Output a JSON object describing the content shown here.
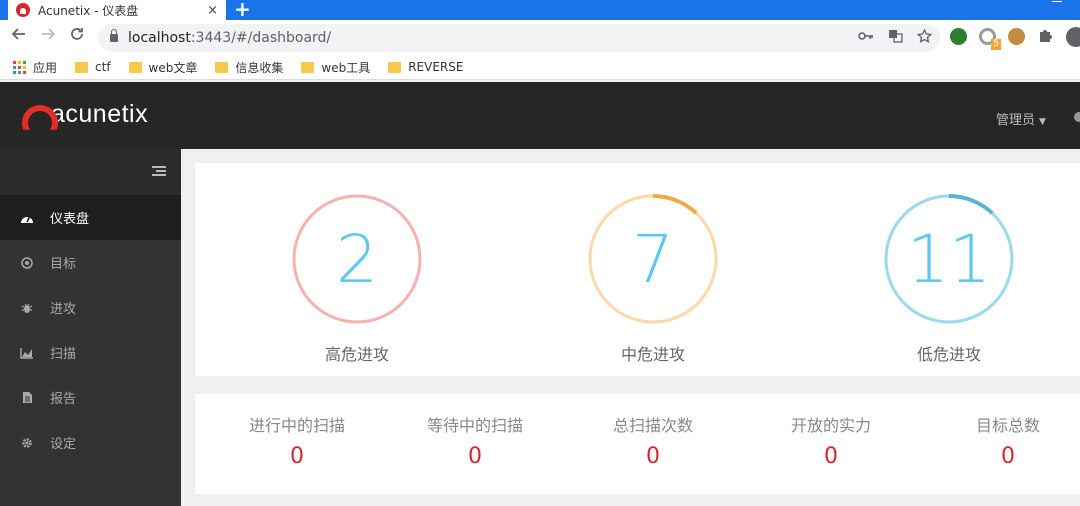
{
  "browser": {
    "tab_title": "Acunetix - 仪表盘",
    "tab_close": "×",
    "new_tab": "+",
    "url_host": "localhost",
    "url_path": ":3443/#/dashboard/",
    "ext_badge": "5",
    "icons": {
      "back": "arrow-left-icon",
      "forward": "arrow-right-icon",
      "reload": "reload-icon",
      "lock": "lock-icon",
      "key": "key-icon",
      "translate": "translate-icon",
      "star": "star-icon",
      "puzzle": "extensions-icon"
    }
  },
  "bookmarks": [
    {
      "label": "应用",
      "type": "apps"
    },
    {
      "label": "ctf",
      "type": "folder"
    },
    {
      "label": "web文章",
      "type": "folder"
    },
    {
      "label": "信息收集",
      "type": "folder"
    },
    {
      "label": "web工具",
      "type": "folder"
    },
    {
      "label": "REVERSE",
      "type": "folder"
    }
  ],
  "header": {
    "logo_text": "acunetix",
    "admin_label": "管理员"
  },
  "sidebar": {
    "items": [
      {
        "label": "仪表盘",
        "icon": "dashboard-icon",
        "active": true
      },
      {
        "label": "目标",
        "icon": "target-icon",
        "active": false
      },
      {
        "label": "进攻",
        "icon": "bug-icon",
        "active": false
      },
      {
        "label": "扫描",
        "icon": "chart-icon",
        "active": false
      },
      {
        "label": "报告",
        "icon": "document-icon",
        "active": false
      },
      {
        "label": "设定",
        "icon": "gear-icon",
        "active": false
      }
    ]
  },
  "vulnerabilities": [
    {
      "label": "高危进攻",
      "count": "2",
      "ring_color": "#f6b2b0",
      "accent_color": "#f6b2b0",
      "progress": 0
    },
    {
      "label": "中危进攻",
      "count": "7",
      "ring_color": "#fcd9a6",
      "accent_color": "#f0a941",
      "progress": 0.12
    },
    {
      "label": "低危进攻",
      "count": "11",
      "ring_color": "#9ad9ef",
      "accent_color": "#55b5d8",
      "progress": 0.12
    }
  ],
  "stats": [
    {
      "label": "进行中的扫描",
      "value": "0"
    },
    {
      "label": "等待中的扫描",
      "value": "0"
    },
    {
      "label": "总扫描次数",
      "value": "0"
    },
    {
      "label": "开放的实力",
      "value": "0"
    },
    {
      "label": "目标总数",
      "value": "0"
    }
  ],
  "colors": {
    "number_blue": "#5bc8ec",
    "stat_red": "#d7262e",
    "brand_red": "#e52d27",
    "chrome_blue": "#1a73e8"
  }
}
